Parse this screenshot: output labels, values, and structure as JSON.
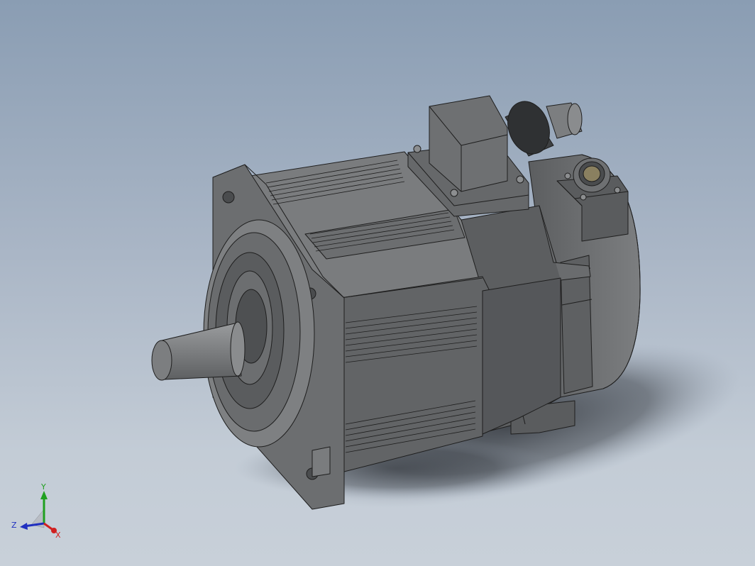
{
  "viewport": {
    "background_top": "#8a9db3",
    "background_bottom": "#c8d0d9",
    "model_color": "#6e7072",
    "model_dark": "#4a4c4e",
    "model_light": "#8c8e90",
    "edge_color": "#1e1e1e"
  },
  "model": {
    "type": "servo motor with flange mount, output shaft, power connector and encoder connector"
  },
  "triad": {
    "x_label": "X",
    "y_label": "Y",
    "z_label": "Z",
    "x_color": "#d02020",
    "y_color": "#20a020",
    "z_color": "#2030c0"
  }
}
